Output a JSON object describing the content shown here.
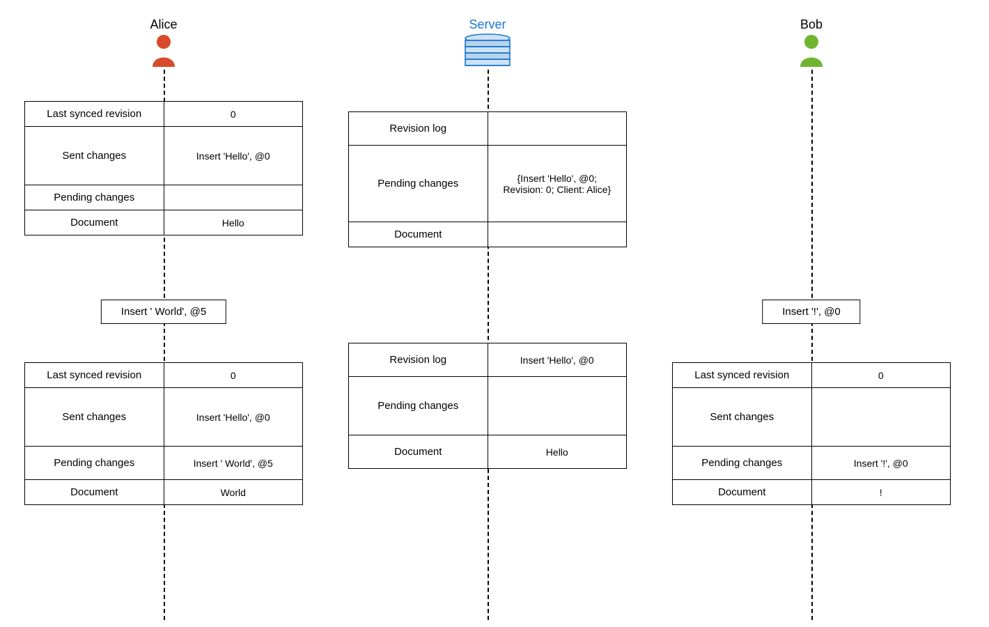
{
  "lanes": {
    "alice": {
      "title": "Alice"
    },
    "server": {
      "title": "Server"
    },
    "bob": {
      "title": "Bob"
    }
  },
  "labels": {
    "last_synced": "Last synced revision",
    "sent": "Sent changes",
    "pending": "Pending changes",
    "document": "Document",
    "revision_log": "Revision log"
  },
  "alice": {
    "state1": {
      "last_synced": "0",
      "sent": "Insert 'Hello', @0",
      "pending": "",
      "document": "Hello"
    },
    "op": "Insert ' World', @5",
    "state2": {
      "last_synced": "0",
      "sent": "Insert 'Hello', @0",
      "pending": "Insert ' World', @5",
      "document": "World"
    }
  },
  "server": {
    "state1": {
      "revision_log": "",
      "pending": "{Insert 'Hello', @0;\nRevision: 0; Client: Alice}",
      "document": ""
    },
    "state2": {
      "revision_log": "Insert 'Hello', @0",
      "pending": "",
      "document": "Hello"
    }
  },
  "bob": {
    "op": "Insert '!', @0",
    "state2": {
      "last_synced": "0",
      "sent": "",
      "pending": "Insert '!', @0",
      "document": "!"
    }
  },
  "colors": {
    "alice": "#d84b2a",
    "bob": "#6fb52e",
    "server_stroke": "#1976d2",
    "server_fill": "#cde1f2"
  }
}
